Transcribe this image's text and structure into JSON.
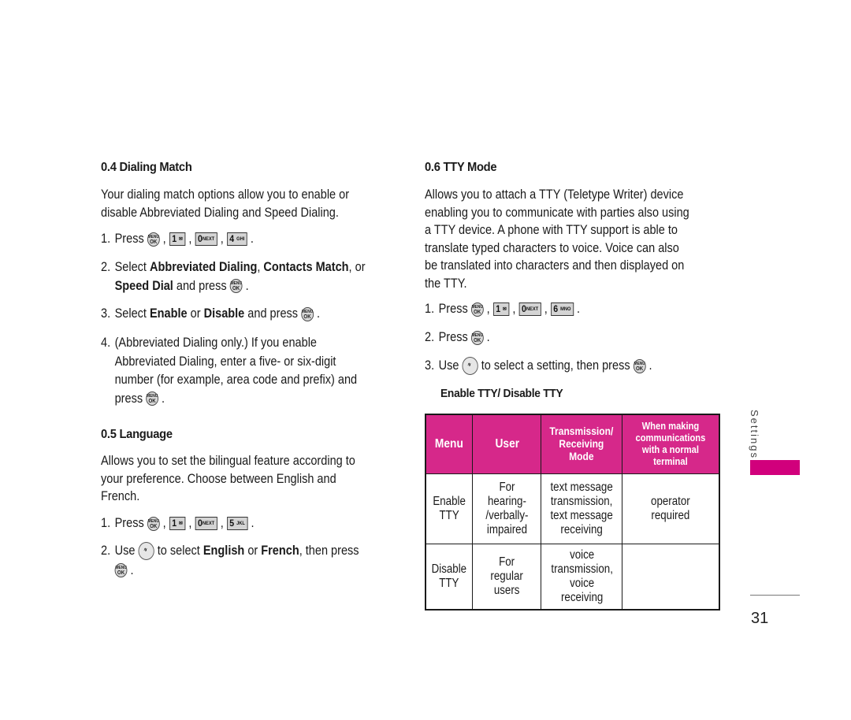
{
  "sections": {
    "dialing_match": {
      "heading": "0.4 Dialing Match",
      "intro": [
        "Your dialing match options allow you to enable or",
        "disable Abbreviated Dialing and Speed Dialing."
      ],
      "step1": {
        "num": "1.",
        "text": "Press",
        "keys": [
          "MENU/OK",
          "1",
          "0 NEXT",
          "4 GHI"
        ]
      },
      "step2": {
        "num": "2.",
        "pre": "Select ",
        "b1": "Abbreviated Dialing",
        "m1": ", ",
        "b2": "Contacts Match",
        "m2": ", or",
        "b3": "Speed Dial",
        "post": " and press"
      },
      "step3": {
        "num": "3.",
        "pre": "Select ",
        "b1": "Enable",
        "m1": " or ",
        "b2": "Disable",
        "post": " and press"
      },
      "step4": {
        "num": "4.",
        "lines": [
          "(Abbreviated Dialing only.) If you enable",
          "Abbreviated Dialing, enter a five- or six-digit",
          "number (for example, area code and prefix) and",
          "press"
        ]
      }
    },
    "language": {
      "heading": "0.5 Language",
      "intro": [
        "Allows you to set the bilingual feature according to",
        "your preference. Choose between English and",
        "French."
      ],
      "step1": {
        "num": "1.",
        "text": "Press",
        "keys": [
          "MENU/OK",
          "1",
          "0 NEXT",
          "5 JKL"
        ]
      },
      "step2": {
        "num": "2.",
        "pre": "Use",
        "mid": " to select ",
        "b1": "English",
        "m1": " or ",
        "b2": "French",
        "post": ", then press"
      }
    },
    "tty_mode": {
      "heading": "0.6 TTY Mode",
      "intro": [
        "Allows you to attach a TTY (Teletype Writer) device",
        "enabling you to communicate with parties also using",
        "a TTY device. A phone with TTY support is able to",
        "translate typed characters to voice. Voice can also",
        "be translated into characters and then displayed on",
        "the TTY."
      ],
      "step1": {
        "num": "1.",
        "text": "Press",
        "keys": [
          "MENU/OK",
          "1",
          "0 NEXT",
          "6 MNO"
        ]
      },
      "step2": {
        "num": "2.",
        "text": "Press"
      },
      "step3": {
        "num": "3.",
        "pre": "Use",
        "post": " to select a setting, then press"
      },
      "options_label": "Enable TTY/ Disable TTY",
      "table": {
        "headers": [
          "Menu",
          "User",
          "Transmission/ Receiving Mode",
          "When making communications with a normal terminal"
        ],
        "rows": [
          [
            "Enable\nTTY",
            "For\nhearing-\n/verbally-\nimpaired",
            "text message\ntransmission,\ntext message\nreceiving",
            "operator\nrequired"
          ],
          [
            "Disable\nTTY",
            "For\nregular\nusers",
            "voice\ntransmission,\nvoice\nreceiving",
            ""
          ]
        ]
      }
    }
  },
  "sidebar": {
    "label": "Settings",
    "accent_color": "#d1007c"
  },
  "table_header_color": "#d6288a",
  "page_number": "31"
}
